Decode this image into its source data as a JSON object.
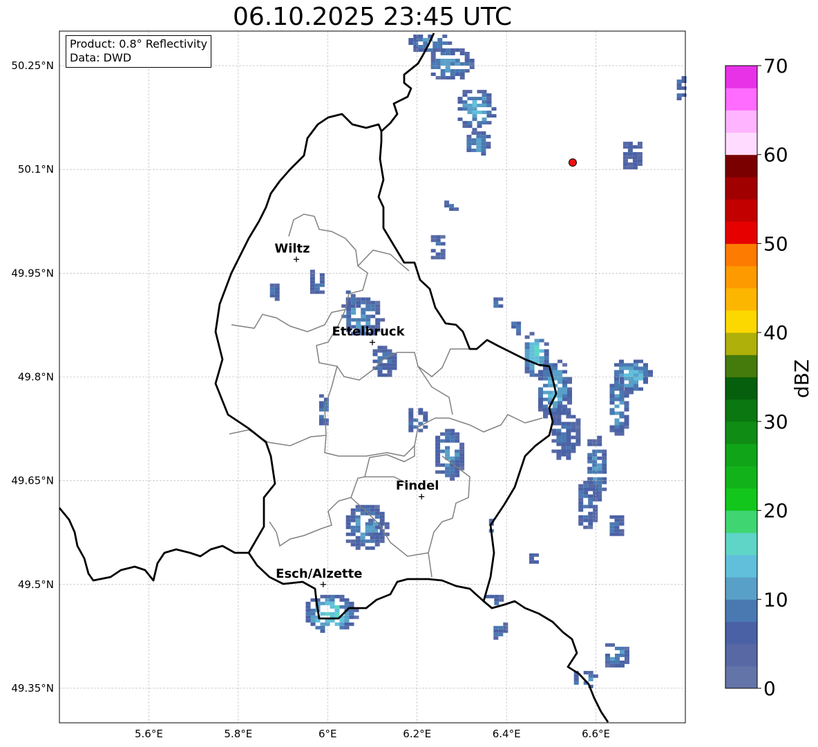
{
  "title": "06.10.2025 23:45 UTC",
  "info": {
    "product": "Product: 0.8° Reflectivity",
    "data": "Data: DWD"
  },
  "map_extent": {
    "lon_min": 5.4,
    "lon_max": 6.8,
    "lat_min": 49.3,
    "lat_max": 50.3
  },
  "lat_ticks": [
    {
      "value": 50.25,
      "label": "50.25°N"
    },
    {
      "value": 50.1,
      "label": "50.1°N"
    },
    {
      "value": 49.95,
      "label": "49.95°N"
    },
    {
      "value": 49.8,
      "label": "49.8°N"
    },
    {
      "value": 49.65,
      "label": "49.65°N"
    },
    {
      "value": 49.5,
      "label": "49.5°N"
    },
    {
      "value": 49.35,
      "label": "49.35°N"
    }
  ],
  "lon_ticks": [
    {
      "value": 5.6,
      "label": "5.6°E"
    },
    {
      "value": 5.8,
      "label": "5.8°E"
    },
    {
      "value": 6.0,
      "label": "6°E"
    },
    {
      "value": 6.2,
      "label": "6.2°E"
    },
    {
      "value": 6.4,
      "label": "6.4°E"
    },
    {
      "value": 6.6,
      "label": "6.6°E"
    }
  ],
  "cities": [
    {
      "name": "Wiltz",
      "lon": 5.93,
      "lat": 49.97
    },
    {
      "name": "Ettelbruck",
      "lon": 6.1,
      "lat": 49.85
    },
    {
      "name": "Findel",
      "lon": 6.21,
      "lat": 49.627
    },
    {
      "name": "Esch/Alzette",
      "lon": 5.99,
      "lat": 49.5
    }
  ],
  "radar_site": {
    "lon": 6.548,
    "lat": 50.11,
    "color": "#ee1111"
  },
  "colorbar": {
    "label": "dBZ",
    "min": 0,
    "max": 70,
    "step": 2.5,
    "ticks": [
      0,
      10,
      20,
      30,
      40,
      50,
      60,
      70
    ],
    "colors": [
      "#6374a8",
      "#5768a5",
      "#4a62a5",
      "#4a79b2",
      "#59a0c8",
      "#61bfdb",
      "#5ed5c6",
      "#3fd672",
      "#12c61b",
      "#12b31a",
      "#10a418",
      "#0f8c14",
      "#0a7711",
      "#065f0c",
      "#457a0c",
      "#afb00a",
      "#fdd800",
      "#fdb600",
      "#fd9a00",
      "#fd7b00",
      "#e60000",
      "#c20000",
      "#a00000",
      "#7a0000",
      "#ffdcff",
      "#ffb4ff",
      "#ff6cff",
      "#e832e8"
    ]
  },
  "colors": {
    "country_border": "#000000",
    "canton_border": "#808080",
    "grid": "#b0b0b0"
  },
  "echoes": [
    [
      6.17,
      6.27,
      50.27,
      50.3,
      3
    ],
    [
      6.22,
      6.32,
      50.23,
      50.28,
      3
    ],
    [
      6.28,
      6.37,
      50.16,
      50.22,
      4
    ],
    [
      6.3,
      6.36,
      50.12,
      50.16,
      3
    ],
    [
      6.25,
      6.29,
      50.04,
      50.06,
      2
    ],
    [
      6.22,
      6.26,
      49.97,
      50.01,
      2
    ],
    [
      6.36,
      6.39,
      49.9,
      49.92,
      2
    ],
    [
      6.4,
      6.43,
      49.86,
      49.89,
      2
    ],
    [
      6.43,
      6.49,
      49.8,
      49.87,
      5
    ],
    [
      6.46,
      6.54,
      49.74,
      49.83,
      4
    ],
    [
      6.49,
      6.56,
      49.68,
      49.76,
      2
    ],
    [
      6.57,
      6.62,
      49.62,
      49.72,
      3
    ],
    [
      6.62,
      6.67,
      49.71,
      49.81,
      3
    ],
    [
      6.63,
      6.72,
      49.78,
      49.83,
      4
    ],
    [
      6.55,
      6.6,
      49.58,
      49.66,
      2
    ],
    [
      6.62,
      6.66,
      49.57,
      49.61,
      2
    ],
    [
      6.54,
      6.6,
      49.35,
      49.38,
      3
    ],
    [
      6.61,
      6.67,
      49.38,
      49.42,
      3
    ],
    [
      6.35,
      6.37,
      49.57,
      49.6,
      2
    ],
    [
      6.44,
      6.47,
      49.53,
      49.55,
      2
    ],
    [
      6.34,
      6.39,
      49.47,
      49.49,
      2
    ],
    [
      6.36,
      6.4,
      49.42,
      49.45,
      2
    ],
    [
      5.94,
      6.06,
      49.43,
      49.49,
      5
    ],
    [
      6.03,
      6.13,
      49.55,
      49.62,
      3
    ],
    [
      6.17,
      6.22,
      49.72,
      49.76,
      2
    ],
    [
      6.23,
      6.3,
      49.65,
      49.73,
      3
    ],
    [
      6.02,
      6.12,
      49.86,
      49.92,
      3
    ],
    [
      6.09,
      6.15,
      49.8,
      49.85,
      2
    ],
    [
      5.86,
      5.89,
      49.91,
      49.94,
      2
    ],
    [
      5.95,
      5.99,
      49.92,
      49.96,
      2
    ],
    [
      5.97,
      6.0,
      49.73,
      49.78,
      2
    ],
    [
      6.03,
      6.06,
      49.9,
      49.93,
      2
    ],
    [
      6.65,
      6.7,
      50.1,
      50.15,
      1
    ],
    [
      6.77,
      6.8,
      50.2,
      50.24,
      2
    ],
    [
      6.08,
      6.12,
      49.57,
      49.6,
      3
    ]
  ]
}
